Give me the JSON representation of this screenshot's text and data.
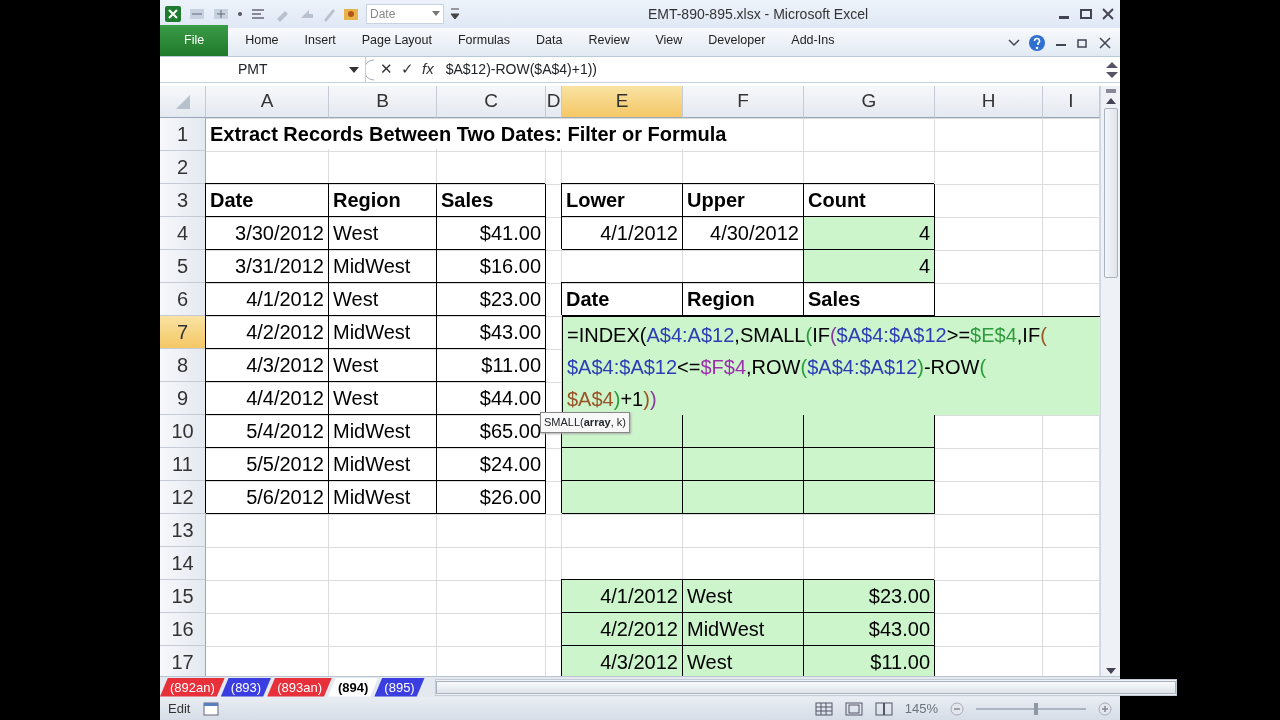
{
  "window": {
    "title": "EMT-890-895.xlsx  -  Microsoft Excel"
  },
  "quick_access": {
    "style_box": "Date"
  },
  "ribbon_tabs": [
    {
      "label": "File",
      "kind": "file"
    },
    {
      "label": "Home",
      "kind": "tab"
    },
    {
      "label": "Insert",
      "kind": "tab"
    },
    {
      "label": "Page Layout",
      "kind": "tab"
    },
    {
      "label": "Formulas",
      "kind": "tab"
    },
    {
      "label": "Data",
      "kind": "tab"
    },
    {
      "label": "Review",
      "kind": "tab"
    },
    {
      "label": "View",
      "kind": "tab"
    },
    {
      "label": "Developer",
      "kind": "tab"
    },
    {
      "label": "Add-Ins",
      "kind": "tab"
    }
  ],
  "formula_bar": {
    "name_box": "PMT",
    "cancel": "✕",
    "enter": "✓",
    "fx": "fx",
    "formula": "$A$12)-ROW($A$4)+1))"
  },
  "columns": [
    {
      "label": "A",
      "selected": false
    },
    {
      "label": "B",
      "selected": false
    },
    {
      "label": "C",
      "selected": false
    },
    {
      "label": "D",
      "selected": false
    },
    {
      "label": "E",
      "selected": true
    },
    {
      "label": "F",
      "selected": false
    },
    {
      "label": "G",
      "selected": false
    },
    {
      "label": "H",
      "selected": false
    },
    {
      "label": "I",
      "selected": false
    }
  ],
  "rows": [
    {
      "number": "1",
      "selected": false,
      "cells": [
        {
          "text": "Extract Records Between Two Dates: Filter or Formula",
          "kind": "title"
        }
      ]
    },
    {
      "number": "2",
      "selected": false,
      "cells": []
    },
    {
      "number": "3",
      "selected": false,
      "cells": [
        {
          "text": "Date",
          "kind": "label",
          "boxed": true
        },
        {
          "text": "Region",
          "kind": "label",
          "boxed": true
        },
        {
          "text": "Sales",
          "kind": "label",
          "boxed": true
        },
        {},
        {
          "text": "Lower",
          "kind": "label",
          "boxed": true
        },
        {
          "text": "Upper",
          "kind": "label",
          "boxed": true
        },
        {
          "text": "Count",
          "kind": "label",
          "boxed": true
        }
      ]
    },
    {
      "number": "4",
      "selected": false,
      "cells": [
        {
          "text": "3/30/2012",
          "kind": "number",
          "boxed": true
        },
        {
          "text": "West",
          "kind": "text",
          "boxed": true
        },
        {
          "text": "$41.00",
          "kind": "number",
          "boxed": true
        },
        {},
        {
          "text": "4/1/2012",
          "kind": "number",
          "boxed": true
        },
        {
          "text": "4/30/2012",
          "kind": "number",
          "boxed": true
        },
        {
          "text": "4",
          "kind": "number",
          "boxed": true,
          "highlighted": true
        }
      ]
    },
    {
      "number": "5",
      "selected": false,
      "cells": [
        {
          "text": "3/31/2012",
          "kind": "number",
          "boxed": true
        },
        {
          "text": "MidWest",
          "kind": "text",
          "boxed": true
        },
        {
          "text": "$16.00",
          "kind": "number",
          "boxed": true
        },
        {},
        {},
        {},
        {
          "text": "4",
          "kind": "number",
          "boxed": true,
          "highlighted": true
        }
      ]
    },
    {
      "number": "6",
      "selected": false,
      "cells": [
        {
          "text": "4/1/2012",
          "kind": "number",
          "boxed": true
        },
        {
          "text": "West",
          "kind": "text",
          "boxed": true
        },
        {
          "text": "$23.00",
          "kind": "number",
          "boxed": true
        },
        {},
        {
          "text": "Date",
          "kind": "label",
          "boxed": true
        },
        {
          "text": "Region",
          "kind": "label",
          "boxed": true
        },
        {
          "text": "Sales",
          "kind": "label",
          "boxed": true
        }
      ]
    },
    {
      "number": "7",
      "selected": true,
      "cells": [
        {
          "text": "4/2/2012",
          "kind": "number",
          "boxed": true
        },
        {
          "text": "MidWest",
          "kind": "text",
          "boxed": true
        },
        {
          "text": "$43.00",
          "kind": "number",
          "boxed": true
        }
      ]
    },
    {
      "number": "8",
      "selected": false,
      "cells": [
        {
          "text": "4/3/2012",
          "kind": "number",
          "boxed": true
        },
        {
          "text": "West",
          "kind": "text",
          "boxed": true
        },
        {
          "text": "$11.00",
          "kind": "number",
          "boxed": true
        }
      ]
    },
    {
      "number": "9",
      "selected": false,
      "cells": [
        {
          "text": "4/4/2012",
          "kind": "number",
          "boxed": true
        },
        {
          "text": "West",
          "kind": "text",
          "boxed": true
        },
        {
          "text": "$44.00",
          "kind": "number",
          "boxed": true
        }
      ]
    },
    {
      "number": "10",
      "selected": false,
      "cells": [
        {
          "text": "5/4/2012",
          "kind": "number",
          "boxed": true
        },
        {
          "text": "MidWest",
          "kind": "text",
          "boxed": true
        },
        {
          "text": "$65.00",
          "kind": "number",
          "boxed": true
        },
        {},
        {
          "boxed": true,
          "highlighted": true
        },
        {
          "boxed": true,
          "highlighted": true
        },
        {
          "boxed": true,
          "highlighted": true
        }
      ]
    },
    {
      "number": "11",
      "selected": false,
      "cells": [
        {
          "text": "5/5/2012",
          "kind": "number",
          "boxed": true
        },
        {
          "text": "MidWest",
          "kind": "text",
          "boxed": true
        },
        {
          "text": "$24.00",
          "kind": "number",
          "boxed": true
        },
        {},
        {
          "boxed": true,
          "highlighted": true
        },
        {
          "boxed": true,
          "highlighted": true
        },
        {
          "boxed": true,
          "highlighted": true
        }
      ]
    },
    {
      "number": "12",
      "selected": false,
      "cells": [
        {
          "text": "5/6/2012",
          "kind": "number",
          "boxed": true
        },
        {
          "text": "MidWest",
          "kind": "text",
          "boxed": true
        },
        {
          "text": "$26.00",
          "kind": "number",
          "boxed": true
        },
        {},
        {
          "boxed": true,
          "highlighted": true
        },
        {
          "boxed": true,
          "highlighted": true
        },
        {
          "boxed": true,
          "highlighted": true
        }
      ]
    },
    {
      "number": "13",
      "selected": false,
      "cells": []
    },
    {
      "number": "14",
      "selected": false,
      "cells": []
    },
    {
      "number": "15",
      "selected": false,
      "cells": [
        {},
        {},
        {},
        {},
        {
          "text": "4/1/2012",
          "kind": "number",
          "boxed": true,
          "highlighted": true
        },
        {
          "text": "West",
          "kind": "text",
          "boxed": true,
          "highlighted": true
        },
        {
          "text": "$23.00",
          "kind": "number",
          "boxed": true,
          "highlighted": true
        }
      ]
    },
    {
      "number": "16",
      "selected": false,
      "cells": [
        {},
        {},
        {},
        {},
        {
          "text": "4/2/2012",
          "kind": "number",
          "boxed": true,
          "highlighted": true
        },
        {
          "text": "MidWest",
          "kind": "text",
          "boxed": true,
          "highlighted": true
        },
        {
          "text": "$43.00",
          "kind": "number",
          "boxed": true,
          "highlighted": true
        }
      ]
    },
    {
      "number": "17",
      "selected": false,
      "cells": [
        {},
        {},
        {},
        {},
        {
          "text": "4/3/2012",
          "kind": "number",
          "boxed": true,
          "highlighted": true
        },
        {
          "text": "West",
          "kind": "text",
          "boxed": true,
          "highlighted": true
        },
        {
          "text": "$11.00",
          "kind": "number",
          "boxed": true,
          "highlighted": true
        }
      ]
    }
  ],
  "cell_editor": {
    "lines": [
      [
        {
          "text": "=INDEX(",
          "color": "#000000"
        },
        {
          "text": "A$4:A$12",
          "color": "#2c3db5"
        },
        {
          "text": ",SMALL",
          "color": "#000000"
        },
        {
          "text": "(",
          "color": "#2e9b3a"
        },
        {
          "text": "IF",
          "color": "#000000"
        },
        {
          "text": "(",
          "color": "#8a3a9e"
        },
        {
          "text": "$A$4:$A$12",
          "color": "#2c3db5"
        },
        {
          "text": ">=",
          "color": "#000000"
        },
        {
          "text": "$E$4",
          "color": "#2e9b3a"
        },
        {
          "text": ",IF",
          "color": "#000000"
        },
        {
          "text": "(",
          "color": "#9a5226"
        }
      ],
      [
        {
          "text": "$A$4:$A$12",
          "color": "#2c3db5"
        },
        {
          "text": "<=",
          "color": "#000000"
        },
        {
          "text": "$F$4",
          "color": "#9b2fae"
        },
        {
          "text": ",ROW",
          "color": "#000000"
        },
        {
          "text": "(",
          "color": "#2e9b3a"
        },
        {
          "text": "$A$4:$A$12",
          "color": "#2c3db5"
        },
        {
          "text": ")",
          "color": "#2e9b3a"
        },
        {
          "text": "-ROW",
          "color": "#000000"
        },
        {
          "text": "(",
          "color": "#2e9b3a"
        }
      ],
      [
        {
          "text": "$A$4",
          "color": "#9a5226"
        },
        {
          "text": ")",
          "color": "#2e9b3a"
        },
        {
          "text": "+1",
          "color": "#000000"
        },
        {
          "text": ")",
          "color": "#9a5226"
        },
        {
          "text": ")",
          "color": "#8a3a9e"
        }
      ]
    ],
    "tooltip": "SMALL(**array**, k)"
  },
  "sheet_tabs": [
    {
      "label": "(892an)",
      "selected": false,
      "color": "#e8303a"
    },
    {
      "label": "(893)",
      "selected": false,
      "color": "#3a3ee0"
    },
    {
      "label": "(893an)",
      "selected": false,
      "color": "#e8303a"
    },
    {
      "label": "(894)",
      "selected": true
    },
    {
      "label": "(895)",
      "selected": false,
      "color": "#3a3ee0"
    }
  ],
  "status_bar": {
    "mode": "Edit",
    "zoom": "145%",
    "level": 0.55
  }
}
